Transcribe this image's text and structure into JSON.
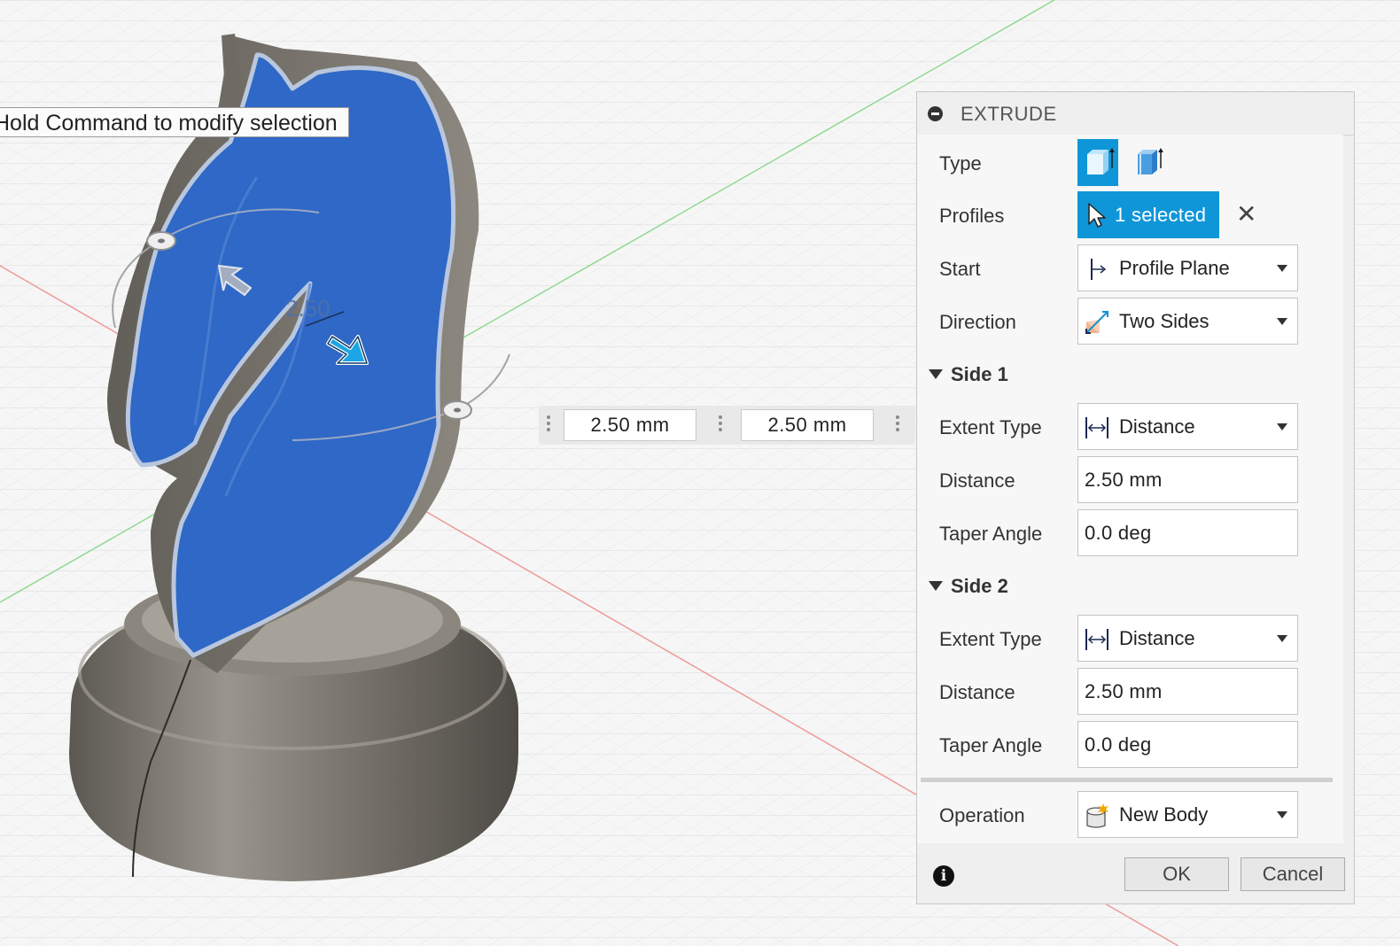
{
  "viewport": {
    "tooltip": "Hold Command to modify selection",
    "dimension_label": "2.50",
    "side1_value": "2.50 mm",
    "side2_value": "2.50 mm"
  },
  "panel": {
    "title": "EXTRUDE",
    "type_label": "Type",
    "profiles_label": "Profiles",
    "profiles_value": "1 selected",
    "start_label": "Start",
    "start_value": "Profile Plane",
    "direction_label": "Direction",
    "direction_value": "Two Sides",
    "side1": {
      "title": "Side 1",
      "extent_label": "Extent Type",
      "extent_value": "Distance",
      "distance_label": "Distance",
      "distance_value": "2.50 mm",
      "taper_label": "Taper Angle",
      "taper_value": "0.0 deg"
    },
    "side2": {
      "title": "Side 2",
      "extent_label": "Extent Type",
      "extent_value": "Distance",
      "distance_label": "Distance",
      "distance_value": "2.50 mm",
      "taper_label": "Taper Angle",
      "taper_value": "0.0 deg"
    },
    "operation_label": "Operation",
    "operation_value": "New Body",
    "ok_label": "OK",
    "cancel_label": "Cancel"
  },
  "colors": {
    "accent": "#0f96d8",
    "profile_fill": "#2f68c6",
    "body_gray": "#77736c"
  },
  "icons": {
    "type_one": "extrude-solid-icon",
    "type_two": "extrude-thin-icon",
    "profiles": "cursor-arrow-icon",
    "clear": "close-icon",
    "start": "profile-plane-icon",
    "direction": "two-sides-icon",
    "extent": "distance-icon",
    "operation": "new-body-icon",
    "info": "info-icon"
  }
}
